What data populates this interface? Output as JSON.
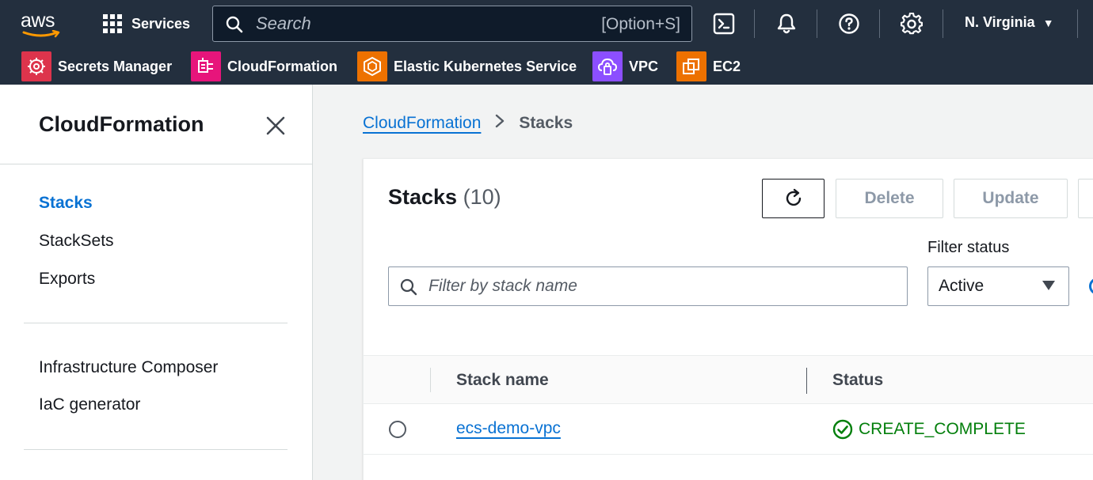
{
  "topnav": {
    "logo_text": "aws",
    "services_label": "Services",
    "search_placeholder": "Search",
    "search_shortcut": "[Option+S]",
    "region_label": "N. Virginia",
    "icons": [
      "cloudshell-icon",
      "bell-icon",
      "help-icon",
      "gear-icon"
    ]
  },
  "favorites": [
    {
      "label": "Secrets Manager",
      "color": "#dd344c"
    },
    {
      "label": "CloudFormation",
      "color": "#e7157b"
    },
    {
      "label": "Elastic Kubernetes Service",
      "color": "#ed7100"
    },
    {
      "label": "VPC",
      "color": "#8c4fff"
    },
    {
      "label": "EC2",
      "color": "#ed7100"
    }
  ],
  "sidebar": {
    "title": "CloudFormation",
    "items": [
      {
        "label": "Stacks",
        "active": true
      },
      {
        "label": "StackSets"
      },
      {
        "label": "Exports"
      },
      {
        "label": "Infrastructure Composer"
      },
      {
        "label": "IaC generator"
      }
    ]
  },
  "breadcrumb": {
    "root": "CloudFormation",
    "current": "Stacks"
  },
  "panel": {
    "title": "Stacks",
    "count": "(10)",
    "buttons": {
      "delete": "Delete",
      "update": "Update"
    },
    "filter_label": "Filter status",
    "filter_placeholder": "Filter by stack name",
    "filter_value": "Active",
    "columns": {
      "name": "Stack name",
      "status": "Status"
    },
    "rows": [
      {
        "name": "ecs-demo-vpc",
        "status": "CREATE_COMPLETE"
      }
    ]
  },
  "colors": {
    "nav_bg": "#232f3e",
    "link": "#0972d3",
    "success": "#037f0c"
  }
}
